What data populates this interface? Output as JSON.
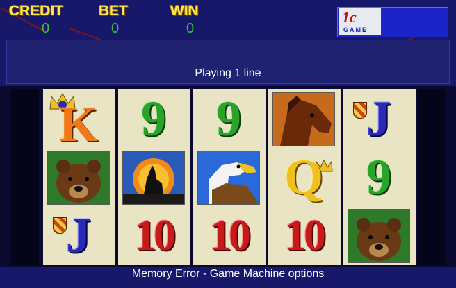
{
  "header": {
    "credit_label": "CREDIT",
    "bet_label": "BET",
    "win_label": "WIN",
    "credit_value": "0",
    "bet_value": "0",
    "win_value": "0"
  },
  "logo": {
    "main": "1c",
    "sub": "GAME"
  },
  "message": "Playing 1 line",
  "status_bar": "Memory Error - Game Machine options",
  "reels": [
    [
      "K",
      "bear",
      "J"
    ],
    [
      "9",
      "wolf",
      "10"
    ],
    [
      "9",
      "eagle",
      "10"
    ],
    [
      "horse",
      "Q",
      "10"
    ],
    [
      "J",
      "9",
      "bear"
    ]
  ],
  "colors": {
    "label_yellow": "#ffe64a",
    "value_green": "#37c23a",
    "background_navy": "#18186a"
  }
}
